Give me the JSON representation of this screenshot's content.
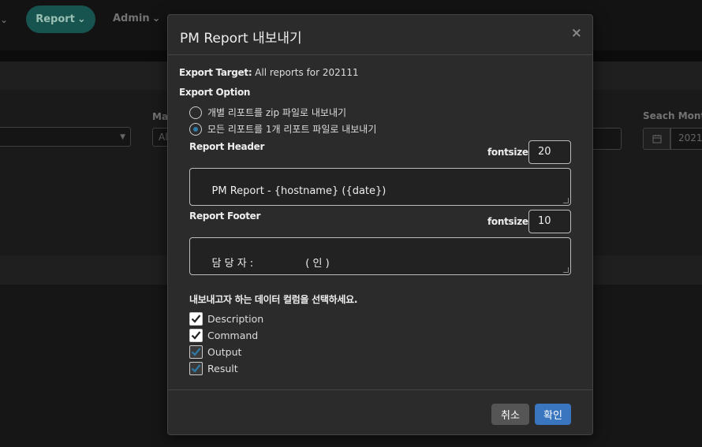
{
  "nav": {
    "report_label": "Report",
    "admin_label": "Admin"
  },
  "background": {
    "label_ma": "Mai",
    "input_al": "All",
    "label_seach_month": "Seach Month",
    "month_value": "2021"
  },
  "modal": {
    "title": "PM Report 내보내기",
    "close_glyph": "×",
    "export_target_label": "Export Target:",
    "export_target_value": "All reports for 202111",
    "export_option_label": "Export Option",
    "options": [
      {
        "label": "개별 리포트를 zip 파일로 내보내기",
        "selected": false
      },
      {
        "label": "모든 리포트를 1개 리포트 파일로 내보내기",
        "selected": true
      }
    ],
    "header_label": "Report Header",
    "header_fontsize_label": "fontsize :",
    "header_fontsize": "20",
    "header_text": "PM Report - {hostname} ({date})",
    "footer_label": "Report Footer",
    "footer_fontsize_label": "fontsize :",
    "footer_fontsize": "10",
    "footer_text": "담 당 자 :                ( 인 )",
    "columns_label": "내보내고자 하는 데이터 컬럼을 선택하세요.",
    "columns": [
      {
        "label": "Description",
        "checked": true
      },
      {
        "label": "Command",
        "checked": true
      },
      {
        "label": "Output",
        "checked": true
      },
      {
        "label": "Result",
        "checked": true
      }
    ],
    "cancel_label": "취소",
    "ok_label": "확인"
  },
  "colors": {
    "accent": "#3a76c0",
    "nav_active": "#1f6f6a",
    "check_blue": "#2f7aa8"
  }
}
